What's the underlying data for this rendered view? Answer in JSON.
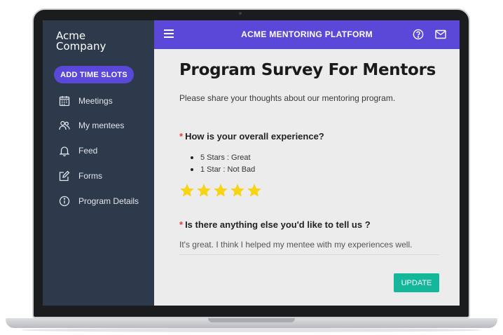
{
  "brand": {
    "line1": "Acme",
    "line2": "Company"
  },
  "sidebar": {
    "add_button_label": "ADD TIME SLOTS",
    "items": [
      {
        "label": "Meetings",
        "icon": "calendar-icon"
      },
      {
        "label": "My mentees",
        "icon": "users-icon"
      },
      {
        "label": "Feed",
        "icon": "bell-icon"
      },
      {
        "label": "Forms",
        "icon": "edit-icon"
      },
      {
        "label": "Program Details",
        "icon": "info-icon"
      }
    ]
  },
  "topbar": {
    "title": "ACME MENTORING PLATFORM",
    "icons": [
      "menu-icon",
      "help-icon",
      "mail-icon"
    ]
  },
  "survey": {
    "title": "Program Survey For Mentors",
    "intro": "Please share your thoughts about our mentoring program.",
    "question1": {
      "required_mark": "*",
      "text": "How is your overall experience?",
      "hints": [
        "5 Stars : Great",
        "1 Star : Not Bad"
      ],
      "rating": 5,
      "rating_max": 5
    },
    "question2": {
      "required_mark": "*",
      "text": "Is there anything else you'd like to tell us ?",
      "answer": "It's great. I think I helped my mentee with my experiences well."
    },
    "update_label": "UPDATE"
  },
  "colors": {
    "sidebar_bg": "#2d3a4b",
    "accent": "#5a48d8",
    "update_button": "#14b79a",
    "star": "#f7d416",
    "required": "#e0413a"
  }
}
